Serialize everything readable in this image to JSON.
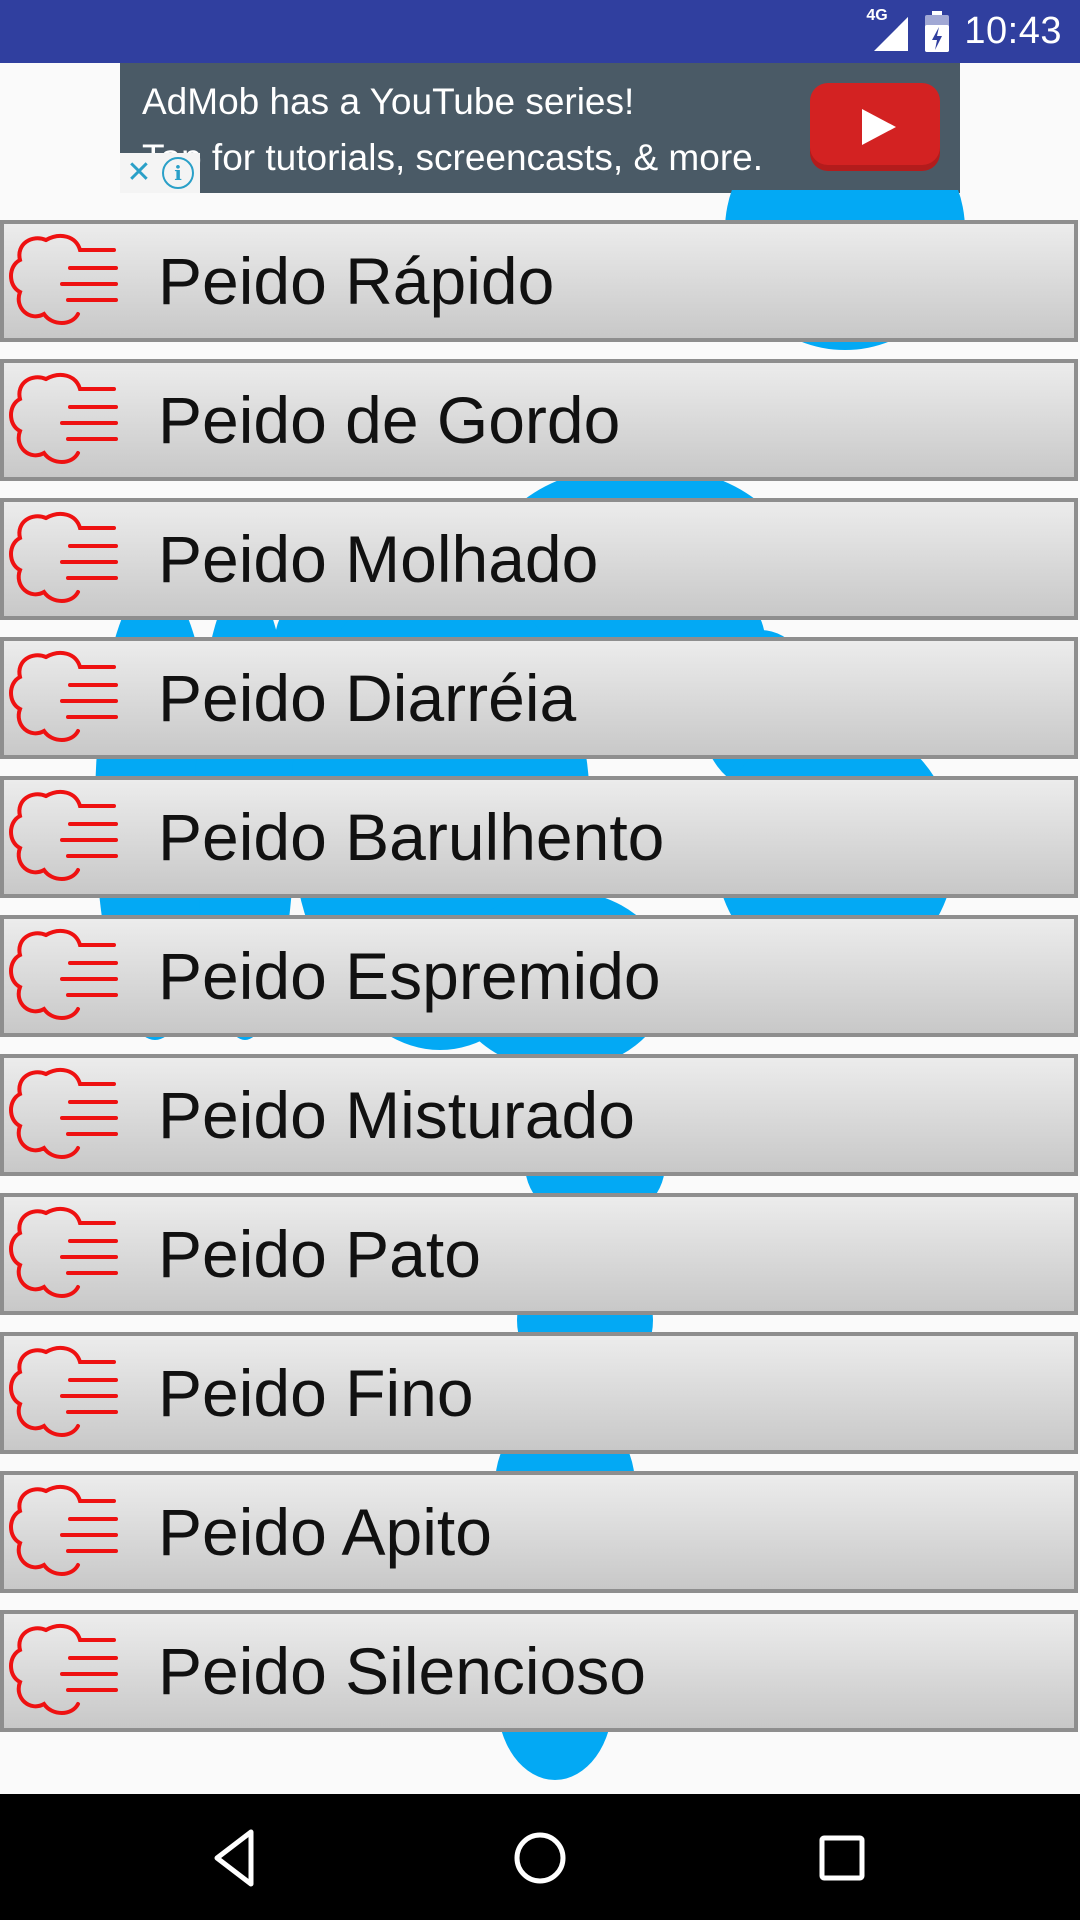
{
  "status_bar": {
    "network": "4G",
    "time": "10:43",
    "icons": [
      "signal-icon",
      "battery-icon"
    ]
  },
  "ad": {
    "line1": "AdMob has a YouTube series!",
    "line2": "Tap for tutorials, screencasts, & more.",
    "icons": [
      "close-icon",
      "info-icon",
      "youtube-play-icon"
    ]
  },
  "list": {
    "item_icon": "fart-cloud-icon",
    "icon_color": "#ee1111",
    "items": [
      {
        "label": "Peido Rápido"
      },
      {
        "label": "Peido de Gordo"
      },
      {
        "label": "Peido Molhado"
      },
      {
        "label": "Peido Diarréia"
      },
      {
        "label": "Peido Barulhento"
      },
      {
        "label": "Peido Espremido"
      },
      {
        "label": "Peido Misturado"
      },
      {
        "label": "Peido Pato"
      },
      {
        "label": "Peido Fino"
      },
      {
        "label": "Peido Apito"
      },
      {
        "label": "Peido Silencioso"
      }
    ]
  },
  "colors": {
    "status_bar": "#303f9f",
    "background_figure": "#03a9f4",
    "row_border": "#8e8e8e"
  },
  "nav_bar": {
    "icons": [
      "back-icon",
      "home-icon",
      "recent-apps-icon"
    ]
  }
}
